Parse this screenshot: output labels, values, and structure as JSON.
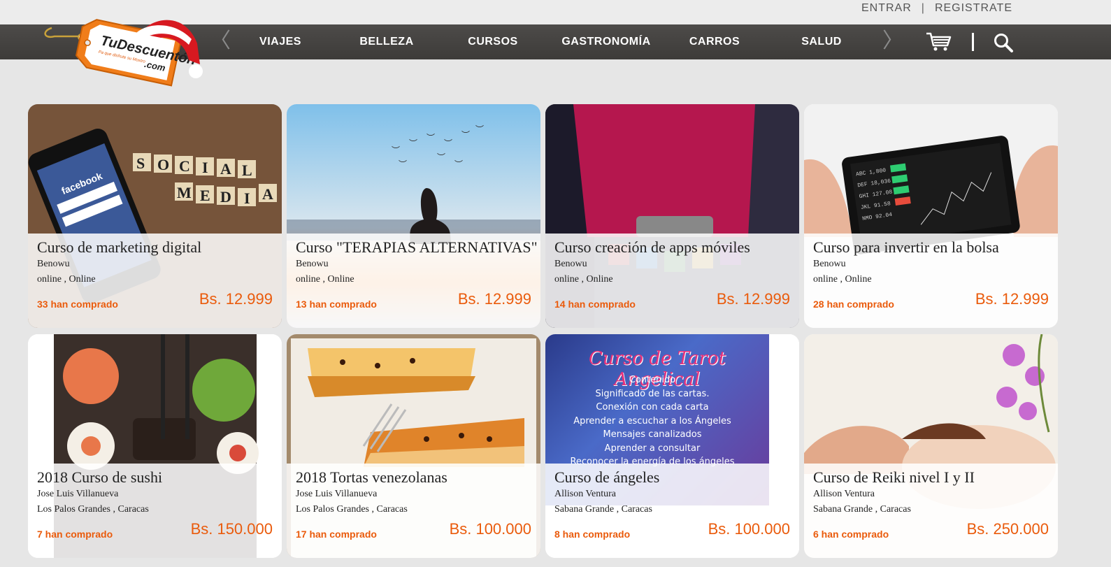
{
  "account": {
    "login": "ENTRAR",
    "separator": "|",
    "register": "REGISTRATE"
  },
  "nav": {
    "prev_arrow": "〈",
    "next_arrow": "〉",
    "items": [
      "VIAJES",
      "BELLEZA",
      "CURSOS",
      "GASTRONOMÍA",
      "CARROS",
      "SALUD"
    ]
  },
  "logo": {
    "text": "TuDescuentón",
    "tld": ".com",
    "tagline": "Pa que disfrute su Mostro"
  },
  "colors": {
    "accent": "#ea5b0c",
    "nav_bg": "#454341",
    "page_bg": "#e6e6e6"
  },
  "cards": [
    {
      "title": "Curso de marketing digital",
      "vendor": "Benowu",
      "location": "online , Online",
      "sold": "33 han comprado",
      "price": "Bs. 12.999",
      "image": "social-media-phone"
    },
    {
      "title": "Curso \"TERAPIAS ALTERNATIVAS\"",
      "vendor": "Benowu",
      "location": "online , Online",
      "sold": "13 han comprado",
      "price": "Bs. 12.999",
      "image": "meditation-sunset"
    },
    {
      "title": "Curso creación de apps móviles",
      "vendor": "Benowu",
      "location": "online , Online",
      "sold": "14 han comprado",
      "price": "Bs. 12.999",
      "image": "phone-apps"
    },
    {
      "title": "Curso para invertir en la bolsa",
      "vendor": "Benowu",
      "location": "online , Online",
      "sold": "28 han comprado",
      "price": "Bs. 12.999",
      "image": "stock-phone"
    },
    {
      "title": "2018 Curso de sushi",
      "vendor": "Jose Luis Villanueva",
      "location": "Los Palos Grandes , Caracas",
      "sold": "7 han comprado",
      "price": "Bs. 150.000",
      "image": "sushi"
    },
    {
      "title": "2018 Tortas venezolanas",
      "vendor": "Jose Luis Villanueva",
      "location": "Los Palos Grandes , Caracas",
      "sold": "17 han comprado",
      "price": "Bs. 100.000",
      "image": "cake"
    },
    {
      "title": "Curso de ángeles",
      "vendor": "Allison Ventura",
      "location": "Sabana Grande , Caracas",
      "sold": "8 han comprado",
      "price": "Bs. 100.000",
      "image": "tarot-poster",
      "poster": {
        "heading": "Curso de Tarot Angelical",
        "lines": [
          "Contenido",
          "Significado de las cartas.",
          "Conexión con cada carta",
          "Aprender a escuchar a los Ángeles",
          "Mensajes canalizados",
          "Aprender a consultar",
          "Reconocer la energía de los ángeles"
        ]
      }
    },
    {
      "title": "Curso de Reiki nivel I y II",
      "vendor": "Allison Ventura",
      "location": "Sabana Grande , Caracas",
      "sold": "6 han comprado",
      "price": "Bs. 250.000",
      "image": "reiki-spa"
    }
  ]
}
